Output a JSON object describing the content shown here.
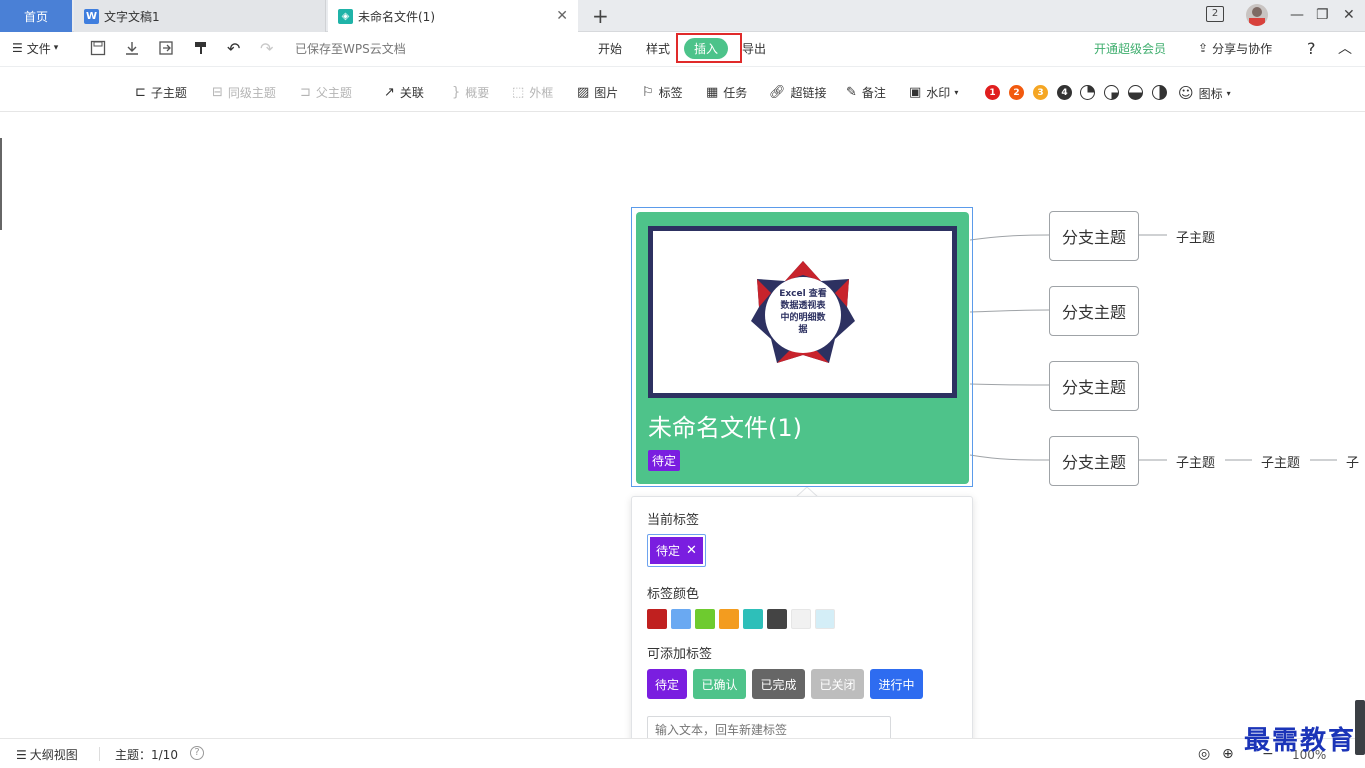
{
  "tabs": {
    "home": "首页",
    "doc": "文字文稿1",
    "active": "未命名文件(1)",
    "add": "+",
    "close": "✕"
  },
  "window": {
    "badge": "2",
    "minimize": "—",
    "restore": "❐",
    "close": "✕"
  },
  "menu": {
    "file": "文件",
    "saved_status": "已保存至WPS云文档",
    "start": "开始",
    "style": "样式",
    "insert": "插入",
    "export": "导出",
    "vip": "开通超级会员",
    "share": "分享与协作",
    "help": "?",
    "collapse": "︿"
  },
  "toolbar": {
    "child_topic": "子主题",
    "sibling_topic": "同级主题",
    "parent_topic": "父主题",
    "relation": "关联",
    "summary": "概要",
    "boundary": "外框",
    "image": "图片",
    "tag": "标签",
    "task": "任务",
    "hyperlink": "超链接",
    "note": "备注",
    "watermark": "水印",
    "icon": "图标",
    "priorities": [
      "1",
      "2",
      "3",
      "4"
    ]
  },
  "mindmap": {
    "root_title": "未命名文件(1)",
    "root_tag": "待定",
    "image_text": "Excel 查看数据透视表中的明细数据",
    "branches": [
      "分支主题",
      "分支主题",
      "分支主题",
      "分支主题"
    ],
    "subtopics": [
      "子主题",
      "子主题",
      "子主题",
      "子"
    ]
  },
  "tag_popup": {
    "current_label": "当前标签",
    "current_tag": "待定",
    "color_label": "标签颜色",
    "colors": [
      "#c0201f",
      "#6aa9f2",
      "#6ecb2f",
      "#f39c1f",
      "#2ebfb9",
      "#444444",
      "#f1f1f1",
      "#d4eef7"
    ],
    "addable_label": "可添加标签",
    "addable_tags": [
      {
        "label": "待定",
        "color": "#7a1ee0"
      },
      {
        "label": "已确认",
        "color": "#4ec38a"
      },
      {
        "label": "已完成",
        "color": "#666666"
      },
      {
        "label": "已关闭",
        "color": "#bdbdbd"
      },
      {
        "label": "进行中",
        "color": "#2e6cf0"
      }
    ],
    "input_placeholder": "输入文本，回车新建标签"
  },
  "statusbar": {
    "outline_view": "大纲视图",
    "topic_count": "主题：1/10",
    "zoom": "100%"
  },
  "watermark_text": "最需教育",
  "colors": {
    "accent_green": "#4ec38a",
    "tab_blue": "#4a80d6",
    "highlight_red": "#e02a2a"
  }
}
